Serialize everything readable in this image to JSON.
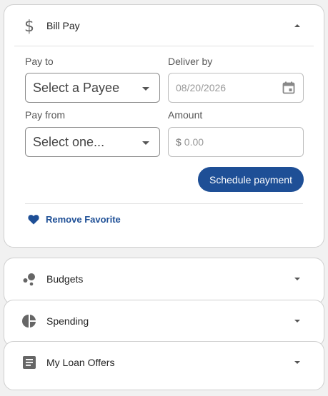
{
  "bill_pay": {
    "title": "Bill Pay",
    "icon": "dollar-icon",
    "expanded": true,
    "pay_to": {
      "label": "Pay to",
      "value": "Select a Payee"
    },
    "deliver_by": {
      "label": "Deliver by",
      "value": "08/20/2026"
    },
    "pay_from": {
      "label": "Pay from",
      "value": "Select one..."
    },
    "amount": {
      "label": "Amount",
      "prefix": "$",
      "placeholder": "0.00"
    },
    "schedule_button": "Schedule payment",
    "favorite_link": "Remove Favorite"
  },
  "budgets": {
    "title": "Budgets",
    "icon": "bubbles-icon",
    "expanded": false
  },
  "spending": {
    "title": "Spending",
    "icon": "pie-chart-icon",
    "expanded": false
  },
  "loan_offers": {
    "title": "My Loan Offers",
    "icon": "document-icon",
    "expanded": false
  },
  "colors": {
    "accent": "#1e4f96",
    "background": "#f1f1f1",
    "card": "#ffffff",
    "icon": "#666666"
  }
}
